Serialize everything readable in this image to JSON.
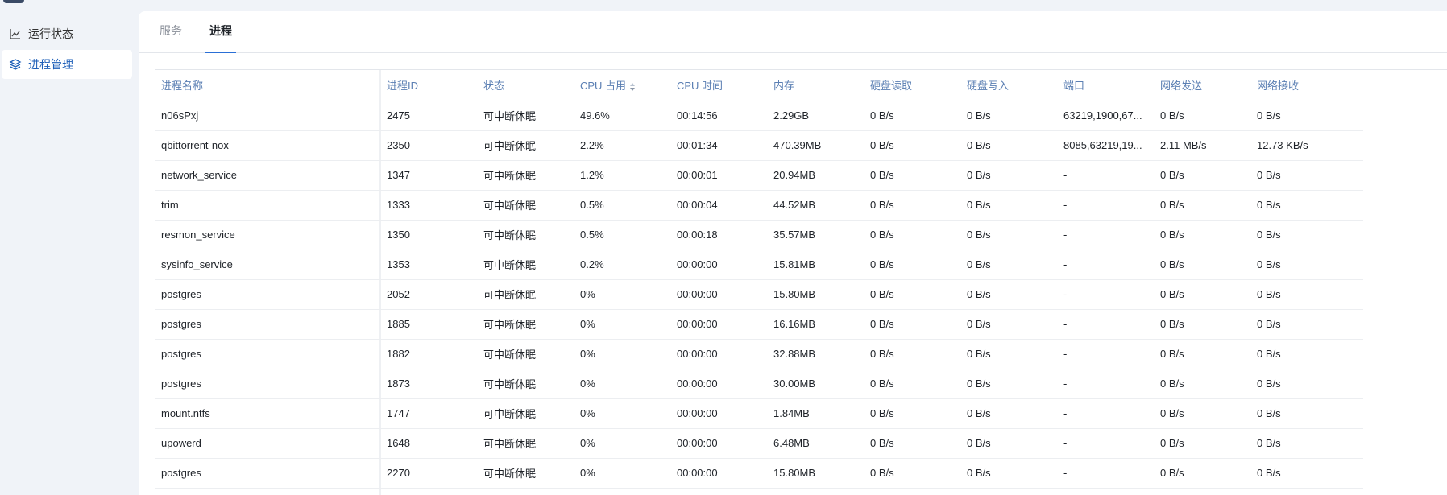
{
  "sidebar": {
    "items": [
      {
        "label": "运行状态",
        "icon": "line-chart-icon"
      },
      {
        "label": "进程管理",
        "icon": "layers-icon"
      }
    ]
  },
  "tabs": [
    {
      "label": "服务"
    },
    {
      "label": "进程"
    }
  ],
  "table": {
    "columns": [
      "进程名称",
      "进程ID",
      "状态",
      "CPU 占用",
      "CPU 时间",
      "内存",
      "硬盘读取",
      "硬盘写入",
      "端口",
      "网络发送",
      "网络接收"
    ],
    "rows": [
      [
        "n06sPxj",
        "2475",
        "可中断休眠",
        "49.6%",
        "00:14:56",
        "2.29GB",
        "0 B/s",
        "0 B/s",
        "63219,1900,67...",
        "0 B/s",
        "0 B/s"
      ],
      [
        "qbittorrent-nox",
        "2350",
        "可中断休眠",
        "2.2%",
        "00:01:34",
        "470.39MB",
        "0 B/s",
        "0 B/s",
        "8085,63219,19...",
        "2.11 MB/s",
        "12.73 KB/s"
      ],
      [
        "network_service",
        "1347",
        "可中断休眠",
        "1.2%",
        "00:00:01",
        "20.94MB",
        "0 B/s",
        "0 B/s",
        "-",
        "0 B/s",
        "0 B/s"
      ],
      [
        "trim",
        "1333",
        "可中断休眠",
        "0.5%",
        "00:00:04",
        "44.52MB",
        "0 B/s",
        "0 B/s",
        "-",
        "0 B/s",
        "0 B/s"
      ],
      [
        "resmon_service",
        "1350",
        "可中断休眠",
        "0.5%",
        "00:00:18",
        "35.57MB",
        "0 B/s",
        "0 B/s",
        "-",
        "0 B/s",
        "0 B/s"
      ],
      [
        "sysinfo_service",
        "1353",
        "可中断休眠",
        "0.2%",
        "00:00:00",
        "15.81MB",
        "0 B/s",
        "0 B/s",
        "-",
        "0 B/s",
        "0 B/s"
      ],
      [
        "postgres",
        "2052",
        "可中断休眠",
        "0%",
        "00:00:00",
        "15.80MB",
        "0 B/s",
        "0 B/s",
        "-",
        "0 B/s",
        "0 B/s"
      ],
      [
        "postgres",
        "1885",
        "可中断休眠",
        "0%",
        "00:00:00",
        "16.16MB",
        "0 B/s",
        "0 B/s",
        "-",
        "0 B/s",
        "0 B/s"
      ],
      [
        "postgres",
        "1882",
        "可中断休眠",
        "0%",
        "00:00:00",
        "32.88MB",
        "0 B/s",
        "0 B/s",
        "-",
        "0 B/s",
        "0 B/s"
      ],
      [
        "postgres",
        "1873",
        "可中断休眠",
        "0%",
        "00:00:00",
        "30.00MB",
        "0 B/s",
        "0 B/s",
        "-",
        "0 B/s",
        "0 B/s"
      ],
      [
        "mount.ntfs",
        "1747",
        "可中断休眠",
        "0%",
        "00:00:00",
        "1.84MB",
        "0 B/s",
        "0 B/s",
        "-",
        "0 B/s",
        "0 B/s"
      ],
      [
        "upowerd",
        "1648",
        "可中断休眠",
        "0%",
        "00:00:00",
        "6.48MB",
        "0 B/s",
        "0 B/s",
        "-",
        "0 B/s",
        "0 B/s"
      ],
      [
        "postgres",
        "2270",
        "可中断休眠",
        "0%",
        "00:00:00",
        "15.80MB",
        "0 B/s",
        "0 B/s",
        "-",
        "0 B/s",
        "0 B/s"
      ]
    ]
  },
  "colors": {
    "accent": "#2a6fd6",
    "header_text": "#5b7fb3",
    "background": "#f0f3f8"
  }
}
